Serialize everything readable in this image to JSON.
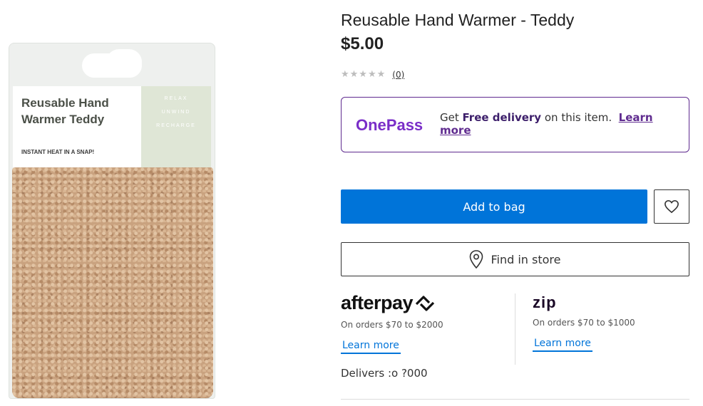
{
  "product": {
    "title": "Reusable Hand Warmer - Teddy",
    "price": "$5.00",
    "rating": {
      "stars": "★★★★★",
      "count": "(0)"
    }
  },
  "packaging": {
    "title": "Reusable Hand Warmer Teddy",
    "tagline": "INSTANT HEAT IN A SNAP!",
    "side_words": [
      "RELAX",
      "UNWIND",
      "RECHARGE"
    ]
  },
  "onepass": {
    "logo": "OnePass",
    "text_prefix": "Get ",
    "text_bold": "Free delivery",
    "text_suffix": " on this item.",
    "link": "Learn more",
    "color": "#5f2b8f"
  },
  "actions": {
    "add_to_bag": "Add to bag",
    "find_in_store": "Find in store",
    "wishlist_icon": "heart-icon",
    "store_icon": "location-pin-icon"
  },
  "payments": {
    "afterpay": {
      "logo": "afterpay",
      "note": "On orders $70 to $2000",
      "link": "Learn more"
    },
    "zip": {
      "logo": "zip",
      "note": "On orders $70 to $1000",
      "link": "Learn more"
    }
  },
  "delivery": {
    "text": "Delivers :o ?000"
  },
  "colors": {
    "accent": "#0074d9",
    "onepass": "#7a2ec8",
    "zip_accent": "#aa8fff"
  }
}
